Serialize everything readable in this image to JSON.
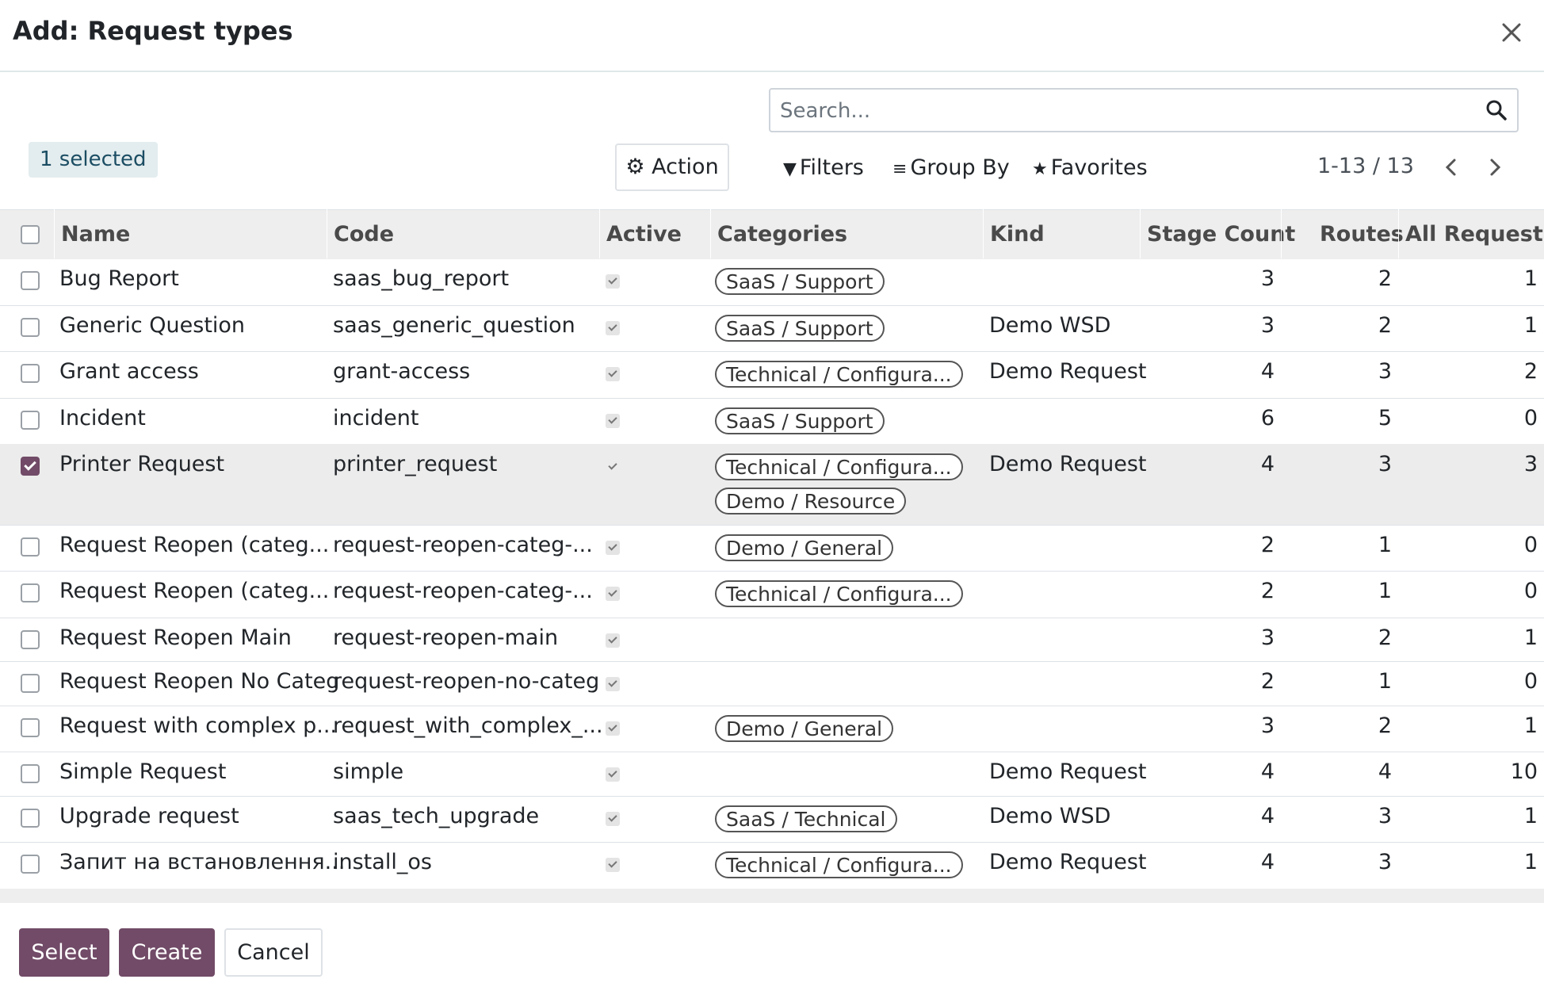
{
  "dialog": {
    "title": "Add: Request types",
    "close_icon": "close-icon"
  },
  "search": {
    "placeholder": "Search..."
  },
  "toolbar": {
    "selected_label": "1 selected",
    "action_label": "Action",
    "filters_label": "Filters",
    "group_by_label": "Group By",
    "favorites_label": "Favorites",
    "pager": "1-13 / 13"
  },
  "table": {
    "columns": [
      "Name",
      "Code",
      "Active",
      "Categories",
      "Kind",
      "Stage Count",
      "Routes",
      "All Requests"
    ],
    "rows": [
      {
        "name": "Bug Report",
        "code": "saas_bug_report",
        "active": true,
        "categories": [
          "SaaS / Support"
        ],
        "kind": "",
        "stage_count": "3",
        "routes": "2",
        "all_requests": "1",
        "selected": false
      },
      {
        "name": "Generic Question",
        "code": "saas_generic_question",
        "active": true,
        "categories": [
          "SaaS / Support"
        ],
        "kind": "Demo WSD",
        "stage_count": "3",
        "routes": "2",
        "all_requests": "1",
        "selected": false
      },
      {
        "name": "Grant access",
        "code": "grant-access",
        "active": true,
        "categories": [
          "Technical / Configura..."
        ],
        "kind": "Demo Request",
        "stage_count": "4",
        "routes": "3",
        "all_requests": "2",
        "selected": false
      },
      {
        "name": "Incident",
        "code": "incident",
        "active": true,
        "categories": [
          "SaaS / Support"
        ],
        "kind": "",
        "stage_count": "6",
        "routes": "5",
        "all_requests": "0",
        "selected": false
      },
      {
        "name": "Printer Request",
        "code": "printer_request",
        "active": true,
        "categories": [
          "Technical / Configura...",
          "Demo / Resource"
        ],
        "kind": "Demo Request",
        "stage_count": "4",
        "routes": "3",
        "all_requests": "3",
        "selected": true
      },
      {
        "name": "Request Reopen (categ...",
        "code": "request-reopen-categ-...",
        "active": true,
        "categories": [
          "Demo / General"
        ],
        "kind": "",
        "stage_count": "2",
        "routes": "1",
        "all_requests": "0",
        "selected": false
      },
      {
        "name": "Request Reopen (categ...",
        "code": "request-reopen-categ-...",
        "active": true,
        "categories": [
          "Technical / Configura..."
        ],
        "kind": "",
        "stage_count": "2",
        "routes": "1",
        "all_requests": "0",
        "selected": false
      },
      {
        "name": "Request Reopen Main",
        "code": "request-reopen-main",
        "active": true,
        "categories": [],
        "kind": "",
        "stage_count": "3",
        "routes": "2",
        "all_requests": "1",
        "selected": false
      },
      {
        "name": "Request Reopen No Categ",
        "code": "request-reopen-no-categ",
        "active": true,
        "categories": [],
        "kind": "",
        "stage_count": "2",
        "routes": "1",
        "all_requests": "0",
        "selected": false
      },
      {
        "name": "Request with complex p...",
        "code": "request_with_complex_...",
        "active": true,
        "categories": [
          "Demo / General"
        ],
        "kind": "",
        "stage_count": "3",
        "routes": "2",
        "all_requests": "1",
        "selected": false
      },
      {
        "name": "Simple Request",
        "code": "simple",
        "active": true,
        "categories": [],
        "kind": "Demo Request",
        "stage_count": "4",
        "routes": "4",
        "all_requests": "10",
        "selected": false
      },
      {
        "name": "Upgrade request",
        "code": "saas_tech_upgrade",
        "active": true,
        "categories": [
          "SaaS / Technical"
        ],
        "kind": "Demo WSD",
        "stage_count": "4",
        "routes": "3",
        "all_requests": "1",
        "selected": false
      },
      {
        "name": "Запит на встановлення...",
        "code": "install_os",
        "active": true,
        "categories": [
          "Technical / Configura..."
        ],
        "kind": "Demo Request",
        "stage_count": "4",
        "routes": "3",
        "all_requests": "1",
        "selected": false
      }
    ]
  },
  "footer": {
    "select_label": "Select",
    "create_label": "Create",
    "cancel_label": "Cancel"
  },
  "colors": {
    "primary": "#714b67",
    "badge_bg": "#e3ecee",
    "header_bg": "#eeeeee"
  }
}
